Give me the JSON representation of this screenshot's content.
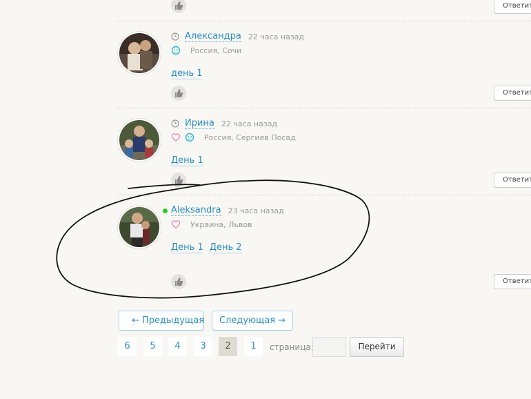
{
  "comments": [
    {
      "author": "",
      "time": "",
      "location": "",
      "links": [],
      "reply_label": "Ответить"
    },
    {
      "author": "Александра",
      "time": "22 часа назад",
      "location": "Россия, Сочи",
      "links": [
        "день 1"
      ],
      "reply_label": "Ответить"
    },
    {
      "author": "Ирина",
      "time": "22 часа назад",
      "location": "Россия, Сергиев Посад",
      "links": [
        "День 1"
      ],
      "reply_label": "Ответить"
    },
    {
      "author": "Aleksandra",
      "time": "23 часа назад",
      "location": "Украина, Львов",
      "links": [
        "День 1",
        "День 2"
      ],
      "reply_label": "Ответить",
      "online": true
    }
  ],
  "pagination": {
    "prev_label": "← Предыдущая",
    "next_label": "Следующая →",
    "pages": [
      "6",
      "5",
      "4",
      "3",
      "2",
      "1"
    ],
    "current_page": "2",
    "page_label": "страница:",
    "page_input_value": "",
    "go_label": "Перейти"
  },
  "colors": {
    "link": "#2c8fbf",
    "online": "#2ec82e",
    "background": "#f8f7f3"
  }
}
